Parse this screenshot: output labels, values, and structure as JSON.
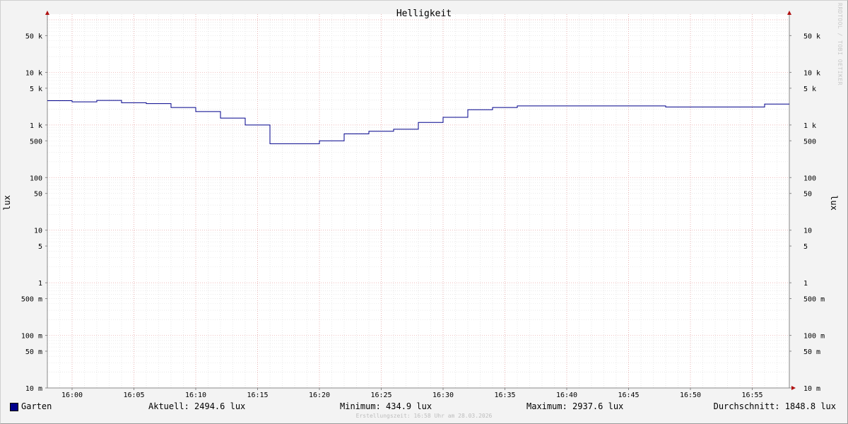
{
  "chart_data": {
    "type": "line",
    "title": "Helligkeit",
    "ylabel": "lux",
    "yscale": "log",
    "ylim": [
      0.01,
      100000
    ],
    "y_ticks": [
      {
        "value": 50000,
        "label": "50 k"
      },
      {
        "value": 10000,
        "label": "10 k"
      },
      {
        "value": 5000,
        "label": "5 k"
      },
      {
        "value": 1000,
        "label": "1 k"
      },
      {
        "value": 500,
        "label": "500"
      },
      {
        "value": 100,
        "label": "100"
      },
      {
        "value": 50,
        "label": "50"
      },
      {
        "value": 10,
        "label": "10"
      },
      {
        "value": 5,
        "label": "5"
      },
      {
        "value": 1,
        "label": "1"
      },
      {
        "value": 0.5,
        "label": "500 m"
      },
      {
        "value": 0.1,
        "label": "100 m"
      },
      {
        "value": 0.05,
        "label": "50 m"
      },
      {
        "value": 0.01,
        "label": "10 m"
      }
    ],
    "x_ticks": [
      "16:00",
      "16:05",
      "16:10",
      "16:15",
      "16:20",
      "16:25",
      "16:30",
      "16:35",
      "16:40",
      "16:45",
      "16:50",
      "16:55"
    ],
    "xlim": [
      "15:58",
      "16:58"
    ],
    "grid": true,
    "step": true,
    "series": [
      {
        "name": "Garten",
        "color": "#00008b",
        "points": [
          [
            "15:58",
            2900
          ],
          [
            "16:00",
            2750
          ],
          [
            "16:02",
            2930
          ],
          [
            "16:04",
            2650
          ],
          [
            "16:06",
            2550
          ],
          [
            "16:08",
            2150
          ],
          [
            "16:10",
            1800
          ],
          [
            "16:12",
            1350
          ],
          [
            "16:14",
            1000
          ],
          [
            "16:16",
            440
          ],
          [
            "16:20",
            500
          ],
          [
            "16:22",
            680
          ],
          [
            "16:24",
            760
          ],
          [
            "16:26",
            830
          ],
          [
            "16:28",
            1120
          ],
          [
            "16:30",
            1400
          ],
          [
            "16:32",
            1950
          ],
          [
            "16:34",
            2150
          ],
          [
            "16:36",
            2300
          ],
          [
            "16:48",
            2200
          ],
          [
            "16:56",
            2500
          ],
          [
            "16:58",
            2500
          ]
        ]
      }
    ]
  },
  "legend": {
    "series_name": "Garten",
    "current": "Aktuell: 2494.6 lux",
    "minimum": "Minimum: 434.9 lux",
    "maximum": "Maximum: 2937.6 lux",
    "average": "Durchschnitt: 1848.8 lux"
  },
  "footer": "Erstellungszeit: 16:58 Uhr am 28.03.2026",
  "credit": "RRDTOOL / TOBI OETIKER"
}
